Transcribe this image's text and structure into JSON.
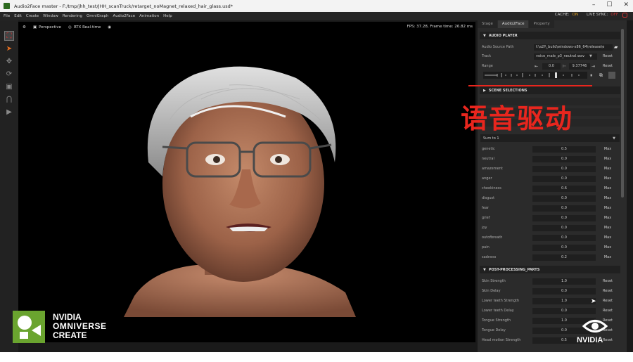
{
  "window": {
    "title": "Audio2Face master - F:/tmp/jhh_test/JHH_scanTruck/retarget_noMagnet_relaxed_hair_glass.usd*"
  },
  "menu": {
    "items": [
      "File",
      "Edit",
      "Create",
      "Window",
      "Rendering",
      "OmniGraph",
      "Audio2Face",
      "Animation",
      "Help"
    ],
    "cache_label": "CACHE:",
    "cache_value": "ON",
    "live_sync_label": "LIVE SYNC:",
    "live_sync_value": "OFF"
  },
  "viewport": {
    "camera": "Perspective",
    "renderer": "RTX Real-time",
    "fps": "FPS: 37.28, Frame time: 26.82 ms"
  },
  "panel": {
    "tabs": [
      "Stage",
      "Audio2Face",
      "Property"
    ],
    "audio_player": {
      "title": "AUDIO PLAYER",
      "source_label": "Audio Source Path",
      "source_value": "f:\\a2f\\_build\\windows-x86_64\\release\\e",
      "track_label": "Track",
      "track_value": "voice_male_p3_neutral.wav",
      "range_label": "Range",
      "range_start": "0.0",
      "range_end": "9.37746",
      "reset": "Reset"
    },
    "scene_selections": "SCENE SELECTIONS",
    "emotion_select": "Sum to 1",
    "emotions": [
      {
        "label": "genetic",
        "value": "0.5"
      },
      {
        "label": "neutral",
        "value": "0.0"
      },
      {
        "label": "amazement",
        "value": "0.0"
      },
      {
        "label": "anger",
        "value": "0.0"
      },
      {
        "label": "cheekiness",
        "value": "0.6"
      },
      {
        "label": "disgust",
        "value": "0.0"
      },
      {
        "label": "fear",
        "value": "0.0"
      },
      {
        "label": "grief",
        "value": "0.0"
      },
      {
        "label": "joy",
        "value": "0.0"
      },
      {
        "label": "outofbreath",
        "value": "0.0"
      },
      {
        "label": "pain",
        "value": "0.0"
      },
      {
        "label": "sadness",
        "value": "0.2"
      }
    ],
    "max_label": "Max",
    "post_processing": {
      "title": "POST-PROCESSING_PARTS",
      "rows": [
        {
          "label": "Skin Strength",
          "value": "1.0"
        },
        {
          "label": "Skin Delay",
          "value": "0.0"
        },
        {
          "label": "Lower teeth Strength",
          "value": "1.0"
        },
        {
          "label": "Lower teeth Delay",
          "value": "0.0"
        },
        {
          "label": "Tongue Strength",
          "value": "1.0"
        },
        {
          "label": "Tongue Delay",
          "value": "0.0"
        },
        {
          "label": "Head motion Strength",
          "value": "0.5"
        }
      ]
    }
  },
  "overlay": {
    "chinese_caption": "语音驱动"
  },
  "branding": {
    "nvidia": "NVIDIA",
    "omniverse": "OMNIVERSE",
    "create": "CREATE",
    "nvidia_right": "NVIDIA"
  },
  "colors": {
    "nvidia_green": "#76b900",
    "caption_red": "#e8261e",
    "panel_bg": "#2b2b2b"
  }
}
